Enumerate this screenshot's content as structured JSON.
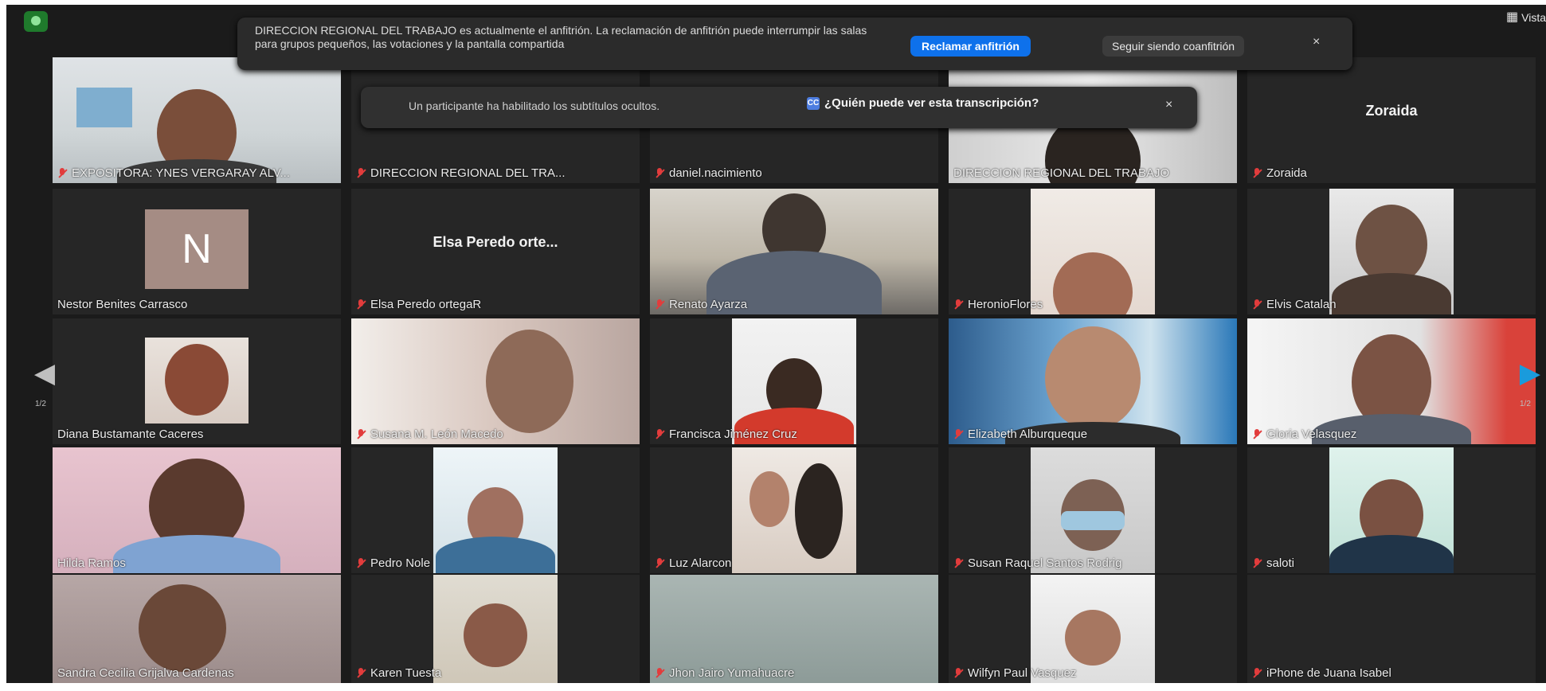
{
  "banner": {
    "text": "DIRECCION REGIONAL DEL TRABAJO es actualmente el anfitrión. La reclamación de anfitrión puede interrumpir las salas para grupos pequeños, las votaciones y la pantalla compartida",
    "claim_button": "Reclamar anfitrión",
    "cohost_button": "Seguir siendo coanfitrión",
    "close": "×"
  },
  "captions": {
    "text": "Un participante ha habilitado los subtítulos ocultos.",
    "link": "¿Quién puede ver esta transcripción?",
    "cc_icon": "cc-icon",
    "close": "×"
  },
  "toolbar": {
    "view_label": "Vista",
    "view_icon": "grid-icon"
  },
  "navigation": {
    "left_page": "1/2",
    "right_page": "1/2"
  },
  "tiles": [
    {
      "name": "EXPOSITORA: YNES VERGARAY ALV...",
      "muted": true
    },
    {
      "name": "DIRECCION REGIONAL DEL TRA...",
      "muted": true
    },
    {
      "name": "daniel.nacimiento",
      "muted": true
    },
    {
      "name": "DIRECCION REGIONAL DEL TRABAJO",
      "muted": false
    },
    {
      "name": "Zoraida",
      "muted": true,
      "display_name": "Zoraida"
    },
    {
      "name": "Nestor Benites Carrasco",
      "muted": false,
      "avatar_letter": "N"
    },
    {
      "name": "Elsa Peredo ortegaR",
      "muted": true,
      "display_name": "Elsa Peredo orte..."
    },
    {
      "name": "Renato Ayarza",
      "muted": true
    },
    {
      "name": "HeronioFlores",
      "muted": true
    },
    {
      "name": "Elvis Catalan",
      "muted": true
    },
    {
      "name": "Diana Bustamante Caceres",
      "muted": false
    },
    {
      "name": "Susana M. León Macedo",
      "muted": true
    },
    {
      "name": "Francisca Jiménez Cruz",
      "muted": true
    },
    {
      "name": "Elizabeth Alburqueque",
      "muted": true
    },
    {
      "name": "Gloria Velasquez",
      "muted": true
    },
    {
      "name": "Hilda Ramos",
      "muted": false
    },
    {
      "name": "Pedro Nole",
      "muted": true
    },
    {
      "name": "Luz Alarcon",
      "muted": true
    },
    {
      "name": "Susan Raquel Santos Rodrig",
      "muted": true
    },
    {
      "name": "saloti",
      "muted": true
    },
    {
      "name": "Sandra Cecilia Grijalva Cardenas",
      "muted": false
    },
    {
      "name": "Karen Tuesta",
      "muted": true
    },
    {
      "name": "Jhon Jairo Yumahuacre",
      "muted": true
    },
    {
      "name": "Wilfyn Paul Vasquez",
      "muted": true
    },
    {
      "name": "iPhone de Juana Isabel",
      "muted": true
    }
  ],
  "colors": {
    "background": "#1b1b1b",
    "tile": "#262626",
    "active_speaker_border": "#d9d58e",
    "primary_button": "#0e71eb",
    "muted_icon": "#e23c3c",
    "next_arrow": "#1a9bdc"
  }
}
